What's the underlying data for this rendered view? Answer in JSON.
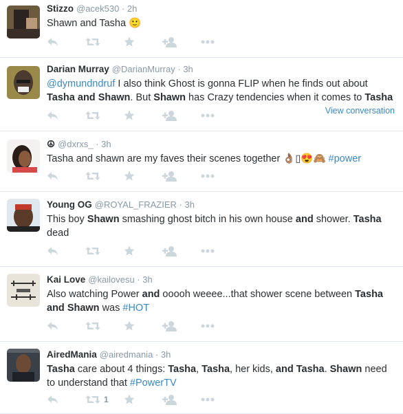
{
  "tweets": [
    {
      "name": "Stizzo",
      "handle": "@acek530",
      "time": "2h",
      "segments": [
        {
          "t": "Shawn and Tasha "
        },
        {
          "t": "🙂",
          "e": true
        }
      ],
      "retweets": ""
    },
    {
      "name": "Darian Murray",
      "handle": "@DarianMurray",
      "time": "3h",
      "segments": [
        {
          "t": "@dymundndruf",
          "l": true
        },
        {
          "t": " I also think Ghost is gonna FLIP when he finds out about "
        },
        {
          "t": "Tasha",
          "b": true
        },
        {
          "t": " "
        },
        {
          "t": "and",
          "b": true
        },
        {
          "t": " "
        },
        {
          "t": "Shawn",
          "b": true
        },
        {
          "t": ". But "
        },
        {
          "t": "Shawn",
          "b": true
        },
        {
          "t": " has Crazy tendencies when it comes to "
        },
        {
          "t": "Tasha",
          "b": true
        }
      ],
      "view_conversation": "View conversation",
      "retweets": ""
    },
    {
      "name": "☮",
      "handle": "@dxrxs_",
      "time": "3h",
      "segments": [
        {
          "t": "Tasha and shawn are my faves their scenes together "
        },
        {
          "t": "👌🏽▯😍🙈 ",
          "e": true
        },
        {
          "t": "#power",
          "l": true
        }
      ],
      "retweets": ""
    },
    {
      "name": "Young OG",
      "handle": "@ROYAL_FRAZIER",
      "time": "3h",
      "segments": [
        {
          "t": "This boy "
        },
        {
          "t": "Shawn",
          "b": true
        },
        {
          "t": " smashing ghost bitch in his own house "
        },
        {
          "t": "and",
          "b": true
        },
        {
          "t": " shower. "
        },
        {
          "t": "Tasha",
          "b": true
        },
        {
          "t": " dead"
        }
      ],
      "retweets": ""
    },
    {
      "name": "Kai Love",
      "handle": "@kailovesu",
      "time": "3h",
      "segments": [
        {
          "t": "Also watching Power "
        },
        {
          "t": "and",
          "b": true
        },
        {
          "t": " ooooh weeee...that shower scene between "
        },
        {
          "t": "Tasha",
          "b": true
        },
        {
          "t": " "
        },
        {
          "t": "and",
          "b": true
        },
        {
          "t": " "
        },
        {
          "t": "Shawn",
          "b": true
        },
        {
          "t": " was "
        },
        {
          "t": "#HOT",
          "l": true
        }
      ],
      "retweets": ""
    },
    {
      "name": "AiredMania",
      "handle": "@airedmania",
      "time": "3h",
      "segments": [
        {
          "t": "Tasha",
          "b": true
        },
        {
          "t": " care about 4 things: "
        },
        {
          "t": "Tasha",
          "b": true
        },
        {
          "t": ", "
        },
        {
          "t": "Tasha",
          "b": true
        },
        {
          "t": ", her kids, "
        },
        {
          "t": "and",
          "b": true
        },
        {
          "t": " "
        },
        {
          "t": "Tasha",
          "b": true
        },
        {
          "t": ". "
        },
        {
          "t": "Shawn",
          "b": true
        },
        {
          "t": " need to understand that "
        },
        {
          "t": "#PowerTV",
          "l": true
        }
      ],
      "retweets": "1"
    }
  ],
  "icons": [
    "reply-icon",
    "retweet-icon",
    "favorite-icon",
    "follow-icon",
    "more-icon"
  ]
}
